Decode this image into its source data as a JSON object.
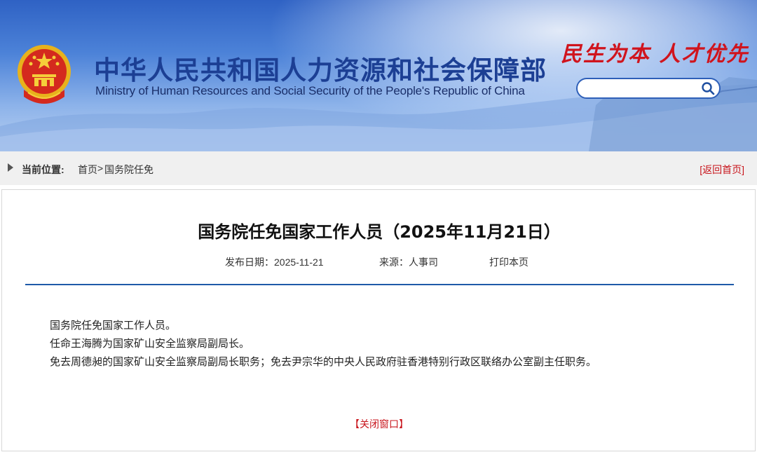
{
  "header": {
    "title_cn": "中华人民共和国人力资源和社会保障部",
    "title_en": "Ministry of Human Resources and Social Security of the People's Republic of China",
    "slogan": "民生为本 人才优先",
    "search": {
      "placeholder": "",
      "value": ""
    }
  },
  "breadcrumb": {
    "label": "当前位置:",
    "home": "首页",
    "separator": ">",
    "current": "国务院任免",
    "back_link": "[返回首页]"
  },
  "article": {
    "title": "国务院任免国家工作人员（2025年11月21日）",
    "publish_date": "发布日期：2025-11-21",
    "source": "来源：人事司",
    "print": "打印本页",
    "paragraphs": [
      "国务院任免国家工作人员。",
      "任命王海腾为国家矿山安全监察局副局长。",
      "免去周德昶的国家矿山安全监察局副局长职务；免去尹宗华的中央人民政府驻香港特别行政区联络办公室副主任职务。"
    ],
    "close": "【关闭窗口】"
  },
  "colors": {
    "banner_top": "#2f62c4",
    "title_blue": "#1c3f94",
    "accent_red": "#c8161d",
    "divider_blue": "#1f5aa8"
  },
  "icons": {
    "emblem": "national-emblem-icon",
    "search": "search-icon",
    "arrow": "triangle-right-icon"
  }
}
